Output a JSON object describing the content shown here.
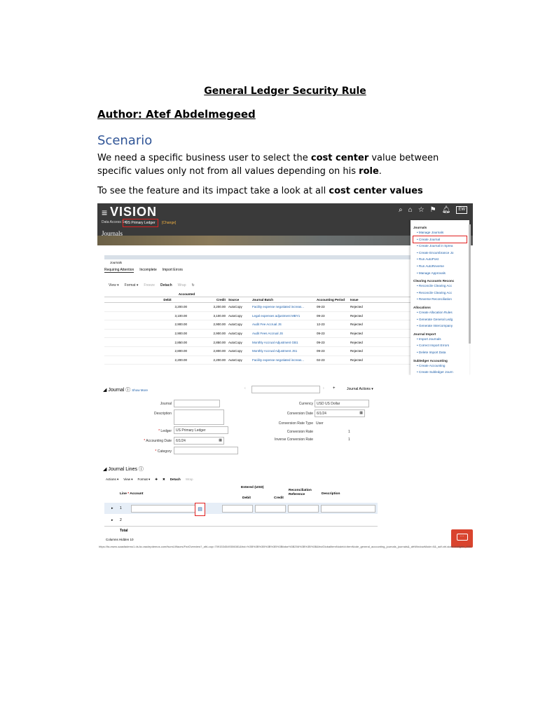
{
  "document": {
    "title": "General Ledger Security Rule",
    "author": "Author: Atef Abdelmegeed",
    "scenario_heading": "Scenario",
    "para1_a": "We need a specific business user to select the ",
    "para1_b": "cost center",
    "para1_c": " value between specific values only not from all values depending on his ",
    "para1_d": "role",
    "para1_e": ".",
    "para2_a": "To see the feature and its impact take a look at all ",
    "para2_b": "cost center values"
  },
  "shot1": {
    "logo": "VISION",
    "data_access_label": "Data Access Set",
    "ledger": "US Primary Ledger",
    "change": "[Change]",
    "page_title": "Journals",
    "badge": "EW",
    "region_title": "Journals",
    "tabs": [
      "Requiring Attention",
      "Incomplete",
      "Import Errors"
    ],
    "tools": [
      "View ▾",
      "Format ▾",
      "Freeze",
      "Detach",
      "Wrap"
    ],
    "columns": [
      "Debit",
      "Credit",
      "Source",
      "Journal Batch",
      "Accounting Period",
      "Issue"
    ],
    "group_header": "Accounted",
    "rows": [
      [
        "3,200.00",
        "3,200.00",
        "AutoCopy",
        "Facility expense negotiated increas...",
        "09-23",
        "Rejected"
      ],
      [
        "3,100.00",
        "3,100.00",
        "AutoCopy",
        "Legal expenses adjustment MBY1",
        "09-23",
        "Rejected"
      ],
      [
        "2,900.00",
        "2,900.00",
        "AutoCopy",
        "Audit Fee Accrual JS",
        "12-23",
        "Rejected"
      ],
      [
        "2,900.00",
        "2,900.00",
        "AutoCopy",
        "Audit Fees Accrual JS",
        "09-23",
        "Rejected"
      ],
      [
        "2,850.00",
        "2,850.00",
        "AutoCopy",
        "Monthly Accrual Adjustment GB1",
        "09-23",
        "Rejected"
      ],
      [
        "2,800.00",
        "2,800.00",
        "AutoCopy",
        "Monthly Accrual Adjustment JS1",
        "09-23",
        "Rejected"
      ],
      [
        "2,200.00",
        "2,200.00",
        "AutoCopy",
        "Facility expense negotiated increas...",
        "02-23",
        "Rejected"
      ]
    ],
    "menu": [
      {
        "heading": "Journals",
        "items": [
          "Manage Journals",
          "Create Journal",
          "Create Journal in Sprea",
          "Create Encumbrance Jo",
          "Run AutoPost",
          "Run AutoReverse",
          "Manage Approvals"
        ]
      },
      {
        "heading": "Clearing Accounts Reconc",
        "items": [
          "Reconcile Clearing Acc",
          "Reconcile Clearing Acc",
          "Reverse Reconciliation"
        ]
      },
      {
        "heading": "Allocations",
        "items": [
          "Create Allocation Rules",
          "Generate General Ledg",
          "Generate Intercompany"
        ]
      },
      {
        "heading": "Journal Import",
        "items": [
          "Import Journals",
          "Correct Import Errors",
          "Delete Import Data"
        ]
      },
      {
        "heading": "Subledger Accounting",
        "items": [
          "Create Accounting",
          "Create Subledger Journ"
        ]
      }
    ]
  },
  "shot2": {
    "header": "Journal",
    "show_more": "Show More",
    "journal_actions": "Journal Actions ▾",
    "labels": {
      "journal": "Journal",
      "description": "Description",
      "ledger": "Ledger",
      "accounting_date": "Accounting Date",
      "category": "Category",
      "currency": "Currency",
      "conversion_date": "Conversion Date",
      "conversion_rate_type": "Conversion Rate Type",
      "conversion_rate": "Conversion Rate",
      "inverse_conversion_rate": "Inverse Conversion Rate"
    },
    "values": {
      "ledger": "US Primary Ledger",
      "accounting_date": "6/1/24",
      "currency": "USD US Dollar",
      "conversion_date": "6/1/24",
      "conversion_rate_type": "User",
      "conversion_rate": "1",
      "inverse_conversion_rate": "1"
    },
    "lines_header": "Journal Lines",
    "lines_tools": [
      "Actions ▾",
      "View ▾",
      "Format ▾",
      "Detach",
      "Wrap"
    ],
    "lines_columns": {
      "line": "Line",
      "account": "Account",
      "entered": "Entered (USD)",
      "debit": "Debit",
      "credit": "Credit",
      "recon": "Reconciliation Reference",
      "description": "Description"
    },
    "line_numbers": [
      "1",
      "2"
    ],
    "total": "Total",
    "columns_hidden": "Columns Hidden  10",
    "url": "https://fa-esew-saasfademo1.ds-fa.oraclepdemos.com/fscmUI/faces/FndOverview?_afrLoop=7091534549306081&fnd=%3B%3B%3B%3B%3B%3Bfalse%3B256%3B%3B%3B&fndGlobalItemNodeId=itemNode_general_accounting_journals_journals&_afrWindowMode=0&_adf.ctrl-state=trwlgrkn_640"
  }
}
